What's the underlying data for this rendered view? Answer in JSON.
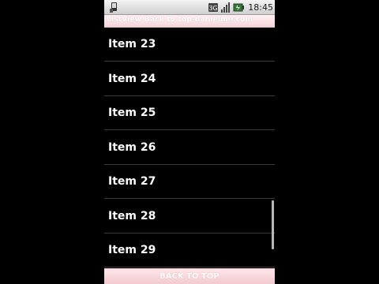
{
  "status_bar": {
    "time": "18:45",
    "icons": [
      "usb-debug-icon",
      "network-3g-icon",
      "signal-bars-icon",
      "battery-charging-icon"
    ]
  },
  "title_bar": {
    "title": "ListView Back to top-danielme.com"
  },
  "list": {
    "items": [
      {
        "label": "Item 23"
      },
      {
        "label": "Item 24"
      },
      {
        "label": "Item 25"
      },
      {
        "label": "Item 26"
      },
      {
        "label": "Item 27"
      },
      {
        "label": "Item 28"
      },
      {
        "label": "Item 29"
      }
    ],
    "scroll_position": 0.9
  },
  "footer": {
    "button_label": "BACK TO TOP"
  },
  "colors": {
    "background": "#000000",
    "title_bar": "#f5d6da",
    "footer": "#f2c9cf",
    "item_text": "#ffffff",
    "divider": "#3a3a3a"
  }
}
